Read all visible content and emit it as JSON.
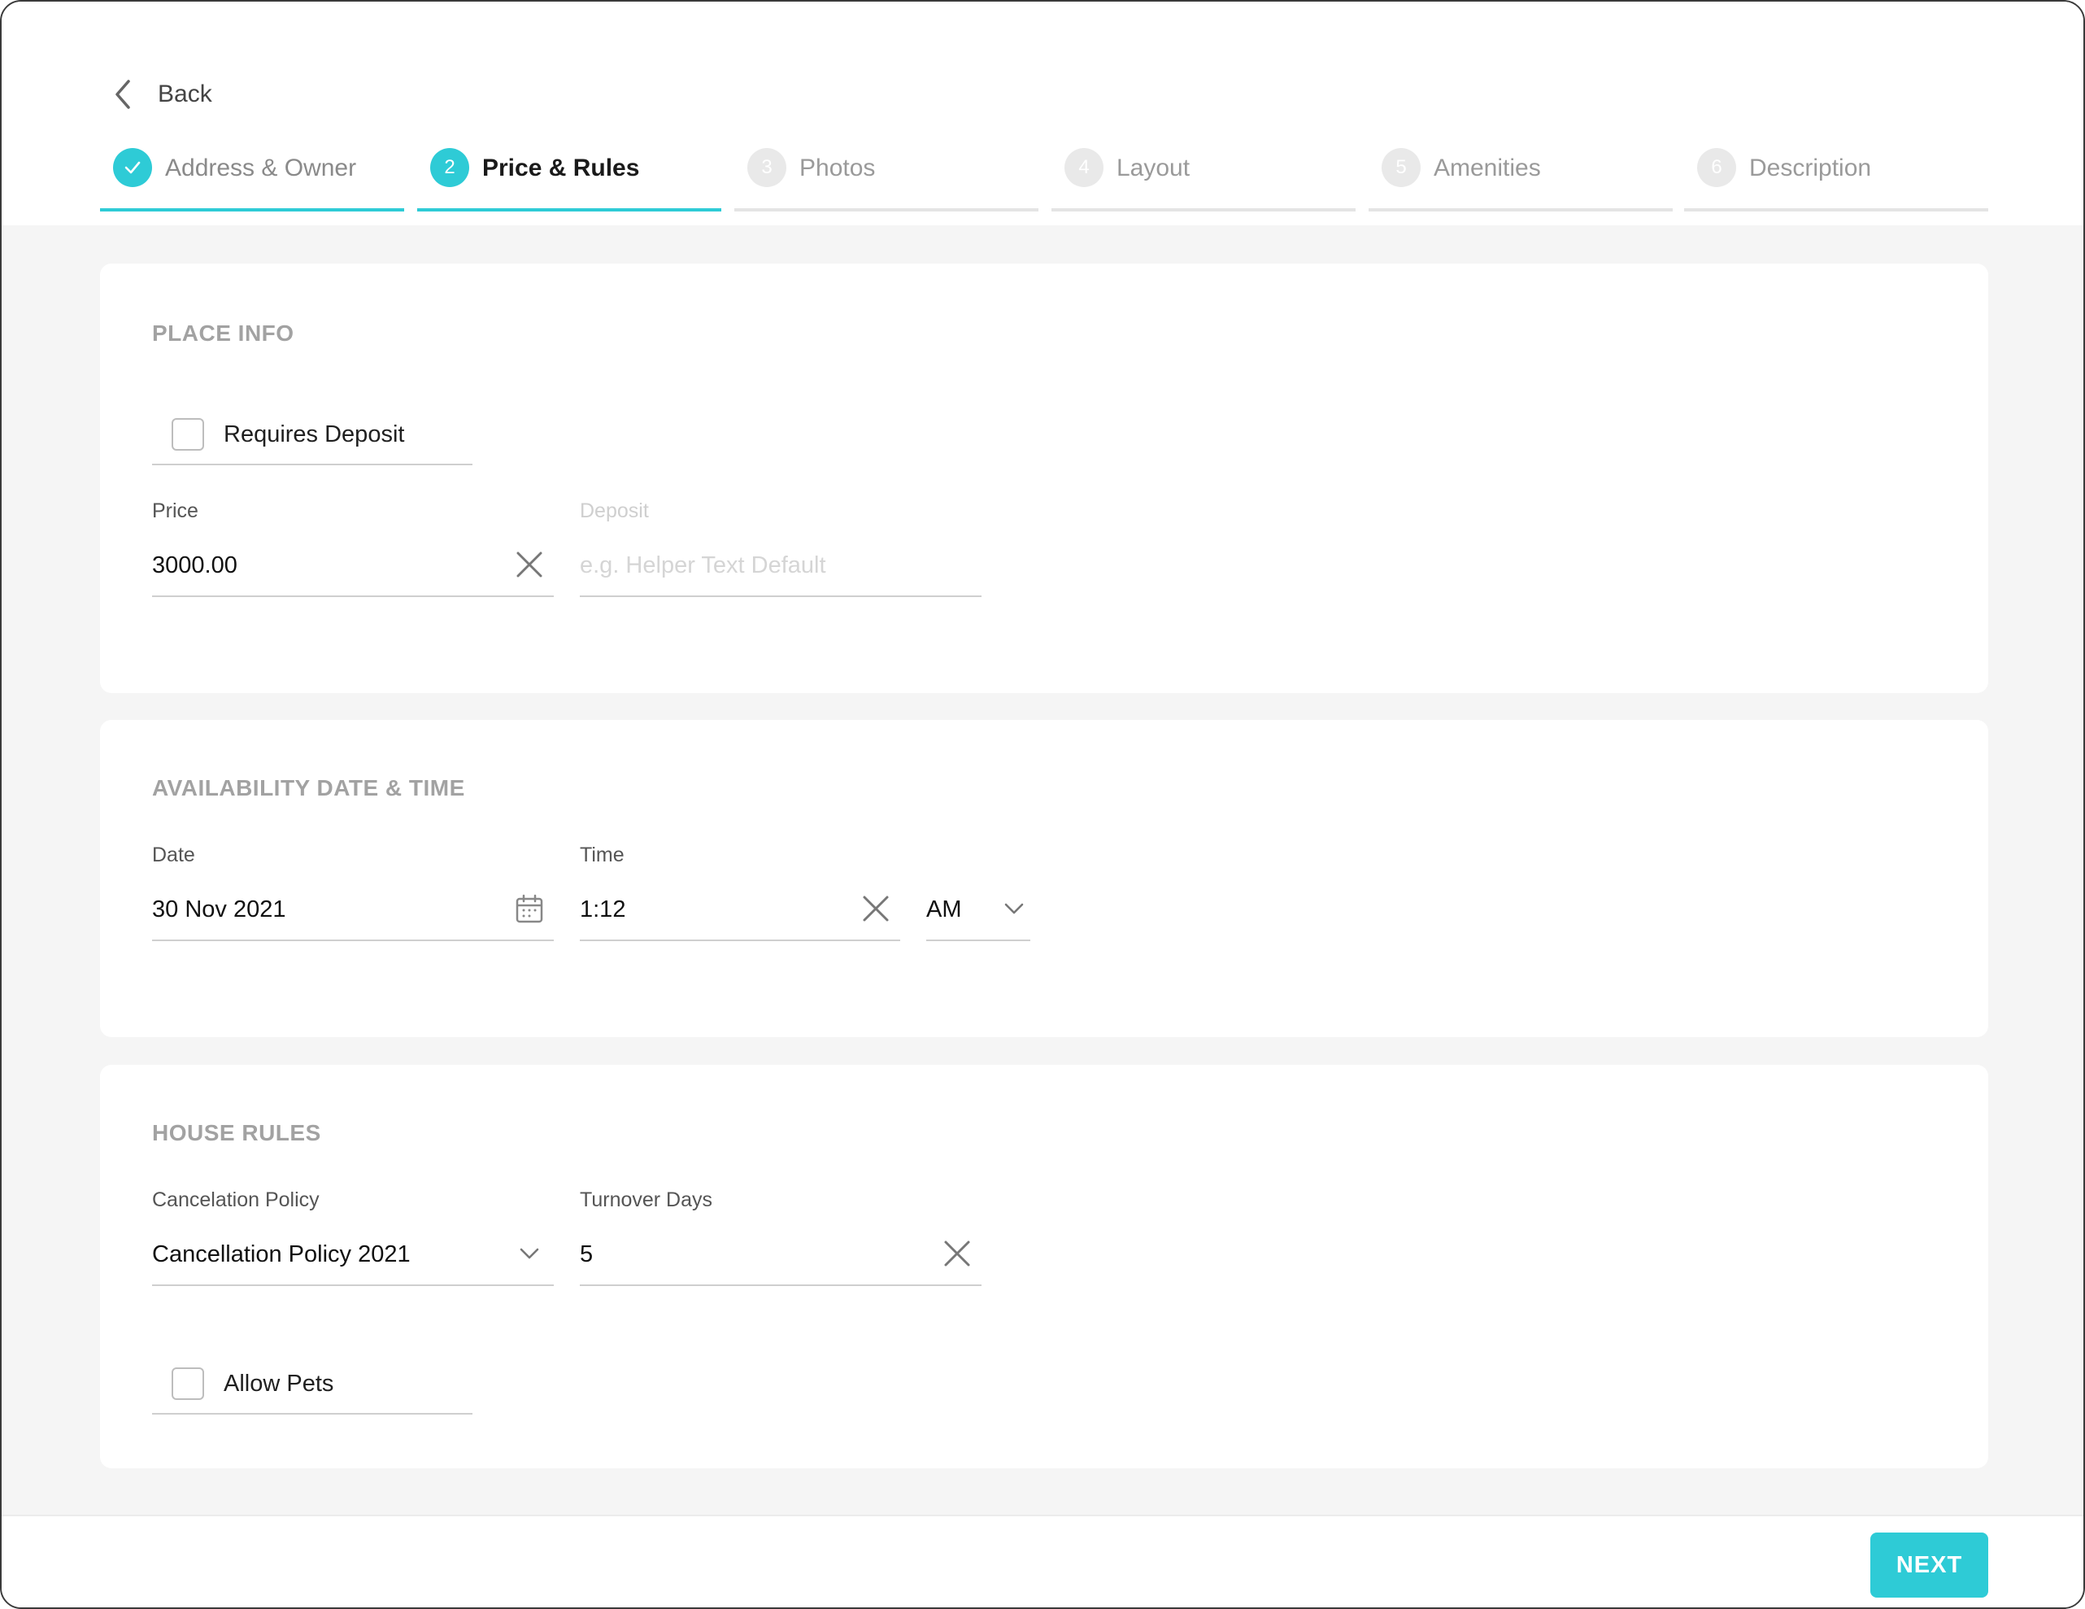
{
  "header": {
    "back_label": "Back",
    "steps": [
      {
        "number": "",
        "label": "Address & Owner",
        "state": "done"
      },
      {
        "number": "2",
        "label": "Price & Rules",
        "state": "active"
      },
      {
        "number": "3",
        "label": "Photos",
        "state": "pending"
      },
      {
        "number": "4",
        "label": "Layout",
        "state": "pending"
      },
      {
        "number": "5",
        "label": "Amenities",
        "state": "pending"
      },
      {
        "number": "6",
        "label": "Description",
        "state": "pending"
      }
    ]
  },
  "place_info": {
    "title": "PLACE INFO",
    "requires_deposit": {
      "label": "Requires Deposit",
      "checked": false
    },
    "price": {
      "label": "Price",
      "value": "3000.00"
    },
    "deposit": {
      "label": "Deposit",
      "placeholder": "e.g. Helper Text Default"
    }
  },
  "availability": {
    "title": "AVAILABILITY DATE & TIME",
    "date": {
      "label": "Date",
      "value": "30 Nov 2021"
    },
    "time": {
      "label": "Time",
      "value": "1:12"
    },
    "meridiem": {
      "value": "AM"
    }
  },
  "house_rules": {
    "title": "HOUSE RULES",
    "cancelation_policy": {
      "label": "Cancelation Policy",
      "value": "Cancellation Policy 2021"
    },
    "turnover_days": {
      "label": "Turnover Days",
      "value": "5"
    },
    "allow_pets": {
      "label": "Allow Pets",
      "checked": false
    }
  },
  "footer": {
    "next_label": "NEXT"
  },
  "colors": {
    "accent": "#2ecbd6",
    "section_title": "#a2a2a2",
    "background": "#f5f5f5"
  }
}
